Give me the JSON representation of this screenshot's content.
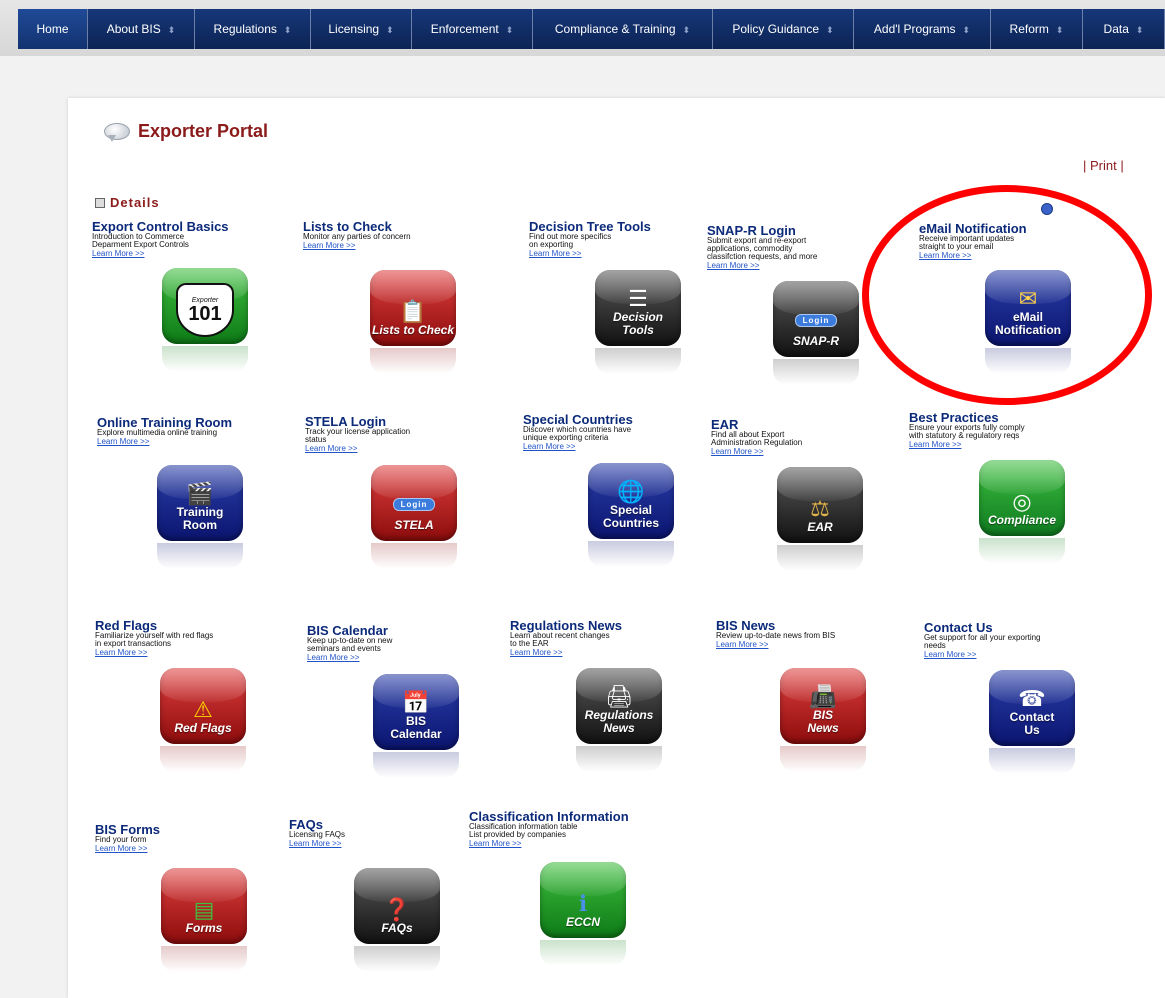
{
  "nav": {
    "items": [
      {
        "label": "Home",
        "active": true
      },
      {
        "label": "About BIS"
      },
      {
        "label": "Regulations"
      },
      {
        "label": "Licensing"
      },
      {
        "label": "Enforcement"
      },
      {
        "label": "Compliance & Training"
      },
      {
        "label": "Policy Guidance"
      },
      {
        "label": "Add'l Programs"
      },
      {
        "label": "Reform"
      },
      {
        "label": "Data"
      }
    ],
    "caret": "⬍"
  },
  "page": {
    "title": "Exporter Portal",
    "print_link": "| Print |",
    "section_label": "Details"
  },
  "tiles": [
    {
      "title": "Export Control Basics",
      "desc": [
        "Introduction to Commerce",
        "Deparment Export Controls"
      ],
      "link": "Learn More >>",
      "icon": "exporter-101-shield-icon",
      "badge_top": "Exporter",
      "badge_main": "101"
    },
    {
      "title": "Lists to Check",
      "desc": [
        "Monitor any parties of concern"
      ],
      "link": "Learn More >>",
      "icon": "clipboard-icon",
      "label": "Lists to Check"
    },
    {
      "title": "Decision Tree Tools",
      "desc": [
        "Find out more specifics",
        "on exporting"
      ],
      "link": "Learn More >>",
      "icon": "flowchart-icon",
      "label": "Decision Tools"
    },
    {
      "title": "SNAP-R Login",
      "desc": [
        "Submit export and re-export",
        "applications, commodity",
        "classifction requests, and more"
      ],
      "link": "Learn More >>",
      "icon": "login-badge-icon",
      "badge": "Login",
      "label": "SNAP-R"
    },
    {
      "title": "eMail Notification",
      "desc": [
        "Receive important updates",
        "straight to your email"
      ],
      "link": "Learn More >>",
      "icon": "envelope-icon",
      "label": "eMail Notification"
    },
    {
      "title": "Online Training Room",
      "desc": [
        "Explore multimedia online training"
      ],
      "link": "Learn More >>",
      "icon": "film-icon",
      "label": "Training Room"
    },
    {
      "title": "STELA Login",
      "desc": [
        "Track your license application",
        "status"
      ],
      "link": "Learn More >>",
      "icon": "login-badge-icon",
      "badge": "Login",
      "label": "STELA"
    },
    {
      "title": "Special Countries",
      "desc": [
        "Discover which countries have",
        "unique exporting criteria"
      ],
      "link": "Learn More >>",
      "icon": "globe-icon",
      "label": "Special Countries"
    },
    {
      "title": "EAR",
      "desc": [
        "Find all about Export",
        "Administration Regulation"
      ],
      "link": "Learn More >>",
      "icon": "scales-icon",
      "label": "EAR"
    },
    {
      "title": "Best Practices",
      "desc": [
        "Ensure your exports fully comply",
        "with statutory & regulatory reqs"
      ],
      "link": "Learn More >>",
      "icon": "target-icon",
      "label": "Compliance"
    },
    {
      "title": "Red Flags",
      "desc": [
        "Familiarize yourself with red flags",
        "in export transactions"
      ],
      "link": "Learn More >>",
      "icon": "warning-icon",
      "label": "Red Flags"
    },
    {
      "title": "BIS Calendar",
      "desc": [
        "Keep up-to-date on new",
        "seminars and events"
      ],
      "link": "Learn More >>",
      "icon": "calendar-icon",
      "label": "BIS Calendar"
    },
    {
      "title": "Regulations News",
      "desc": [
        "Learn about recent changes",
        "to the EAR"
      ],
      "link": "Learn More >>",
      "icon": "printer-icon",
      "label": "Regulations News"
    },
    {
      "title": "BIS News",
      "desc": [
        "Review up-to-date news from BIS"
      ],
      "link": "Learn More >>",
      "icon": "fax-icon",
      "label": "BIS News"
    },
    {
      "title": "Contact Us",
      "desc": [
        "Get support for all your exporting",
        "needs"
      ],
      "link": "Learn More >>",
      "icon": "phone-icon",
      "label": "Contact Us"
    },
    {
      "title": "BIS Forms",
      "desc": [
        "Find your form"
      ],
      "link": "Learn More >>",
      "icon": "form-icon",
      "label": "Forms"
    },
    {
      "title": "FAQs",
      "desc": [
        "Licensing FAQs"
      ],
      "link": "Learn More >>",
      "icon": "question-icon",
      "label": "FAQs"
    },
    {
      "title": "Classification Information",
      "desc": [
        "Classification information table",
        "List provided by companies"
      ],
      "link": "Learn More >>",
      "icon": "info-icon",
      "label": "ECCN"
    }
  ],
  "colors": {
    "nav_bg": "#0f2a5f",
    "title_red": "#8b1a1a",
    "link_blue": "#2153c8",
    "highlight": "#ff0000"
  }
}
